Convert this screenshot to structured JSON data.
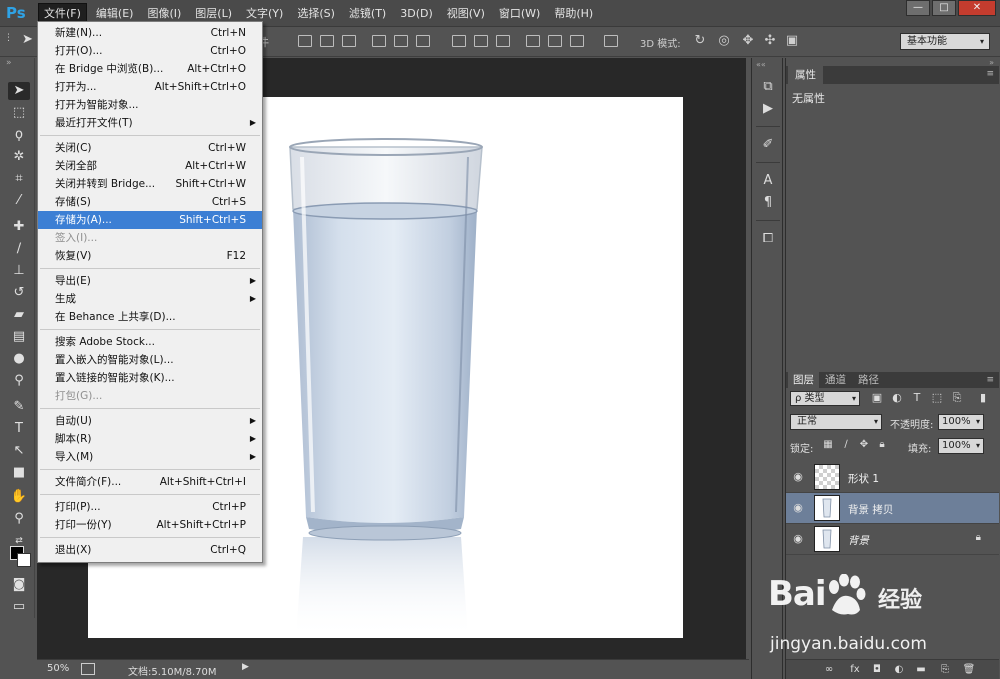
{
  "app": {
    "logo": "Ps"
  },
  "menubar": {
    "items": [
      "文件(F)",
      "编辑(E)",
      "图像(I)",
      "图层(L)",
      "文字(Y)",
      "选择(S)",
      "滤镜(T)",
      "3D(D)",
      "视图(V)",
      "窗口(W)",
      "帮助(H)"
    ],
    "active_index": 0
  },
  "window_controls": {
    "minimize": "—",
    "maximize": "□",
    "close": "✕"
  },
  "options": {
    "sliver_text": "件",
    "mode_3d_label": "3D 模式:",
    "workspace": "基本功能"
  },
  "file_menu": {
    "groups": [
      [
        {
          "label": "新建(N)...",
          "shortcut": "Ctrl+N"
        },
        {
          "label": "打开(O)...",
          "shortcut": "Ctrl+O"
        },
        {
          "label": "在 Bridge 中浏览(B)...",
          "shortcut": "Alt+Ctrl+O"
        },
        {
          "label": "打开为...",
          "shortcut": "Alt+Shift+Ctrl+O"
        },
        {
          "label": "打开为智能对象...",
          "shortcut": ""
        },
        {
          "label": "最近打开文件(T)",
          "shortcut": "",
          "submenu": true
        }
      ],
      [
        {
          "label": "关闭(C)",
          "shortcut": "Ctrl+W"
        },
        {
          "label": "关闭全部",
          "shortcut": "Alt+Ctrl+W"
        },
        {
          "label": "关闭并转到 Bridge...",
          "shortcut": "Shift+Ctrl+W"
        },
        {
          "label": "存储(S)",
          "shortcut": "Ctrl+S"
        },
        {
          "label": "存储为(A)...",
          "shortcut": "Shift+Ctrl+S",
          "highlighted": true
        },
        {
          "label": "签入(I)...",
          "shortcut": "",
          "disabled": true
        },
        {
          "label": "恢复(V)",
          "shortcut": "F12"
        }
      ],
      [
        {
          "label": "导出(E)",
          "shortcut": "",
          "submenu": true
        },
        {
          "label": "生成",
          "shortcut": "",
          "submenu": true
        },
        {
          "label": "在 Behance 上共享(D)...",
          "shortcut": ""
        }
      ],
      [
        {
          "label": "搜索 Adobe Stock...",
          "shortcut": ""
        },
        {
          "label": "置入嵌入的智能对象(L)...",
          "shortcut": ""
        },
        {
          "label": "置入链接的智能对象(K)...",
          "shortcut": ""
        },
        {
          "label": "打包(G)...",
          "shortcut": "",
          "disabled": true
        }
      ],
      [
        {
          "label": "自动(U)",
          "shortcut": "",
          "submenu": true
        },
        {
          "label": "脚本(R)",
          "shortcut": "",
          "submenu": true
        },
        {
          "label": "导入(M)",
          "shortcut": "",
          "submenu": true
        }
      ],
      [
        {
          "label": "文件简介(F)...",
          "shortcut": "Alt+Shift+Ctrl+I"
        }
      ],
      [
        {
          "label": "打印(P)...",
          "shortcut": "Ctrl+P"
        },
        {
          "label": "打印一份(Y)",
          "shortcut": "Alt+Shift+Ctrl+P"
        }
      ],
      [
        {
          "label": "退出(X)",
          "shortcut": "Ctrl+Q"
        }
      ]
    ]
  },
  "properties": {
    "tab": "属性",
    "content": "无属性"
  },
  "layers": {
    "tabs": [
      "图层",
      "通道",
      "路径"
    ],
    "filter": "ρ 类型",
    "blend_mode": "正常",
    "opacity_label": "不透明度:",
    "opacity": "100%",
    "lock_label": "锁定:",
    "fill_label": "填充:",
    "fill": "100%",
    "items": [
      {
        "name": "形状 1",
        "visible": true,
        "selected": false,
        "thumb": "checker"
      },
      {
        "name": "背景 拷贝",
        "visible": true,
        "selected": true,
        "thumb": "glass"
      },
      {
        "name": "背景",
        "visible": true,
        "selected": false,
        "thumb": "glass",
        "locked": true,
        "italic": true
      }
    ]
  },
  "status": {
    "zoom": "50%",
    "doc_size": "文档:5.10M/8.70M"
  },
  "watermark": {
    "brand": "Bai",
    "brand_suffix": "经验",
    "url": "jingyan.baidu.com"
  },
  "colors": {
    "accent": "#3c7fd4",
    "ps_blue": "#2fa3e6",
    "layer_selected": "#6d7f99"
  }
}
